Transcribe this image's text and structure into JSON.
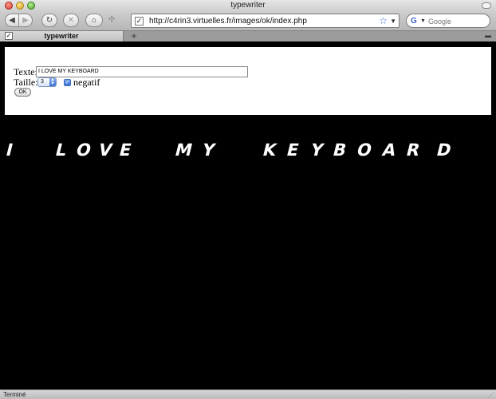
{
  "window": {
    "title": "typewriter"
  },
  "toolbar": {
    "url": "http://c4rin3.virtuelles.fr/images/ok/index.php",
    "search_placeholder": "Google"
  },
  "tabs": [
    {
      "label": "typewriter"
    }
  ],
  "form": {
    "texte_label": "Texte:",
    "texte_value": "I LOVE MY KEYBOARD",
    "taille_label": "Taille:",
    "taille_value": "3",
    "negatif_label": "negatif",
    "negatif_checked": true,
    "ok_label": "OK"
  },
  "output": {
    "chars": [
      "I",
      "",
      "L",
      "O",
      "V",
      "E",
      "",
      "M",
      "Y",
      "",
      "K",
      "E",
      "Y",
      "B",
      "O",
      "A",
      "R",
      "D"
    ]
  },
  "status": {
    "text": "Terminé"
  },
  "colors": {
    "page_background": "#000000",
    "form_background": "#ffffff",
    "typewriter_text": "#ffffff"
  }
}
